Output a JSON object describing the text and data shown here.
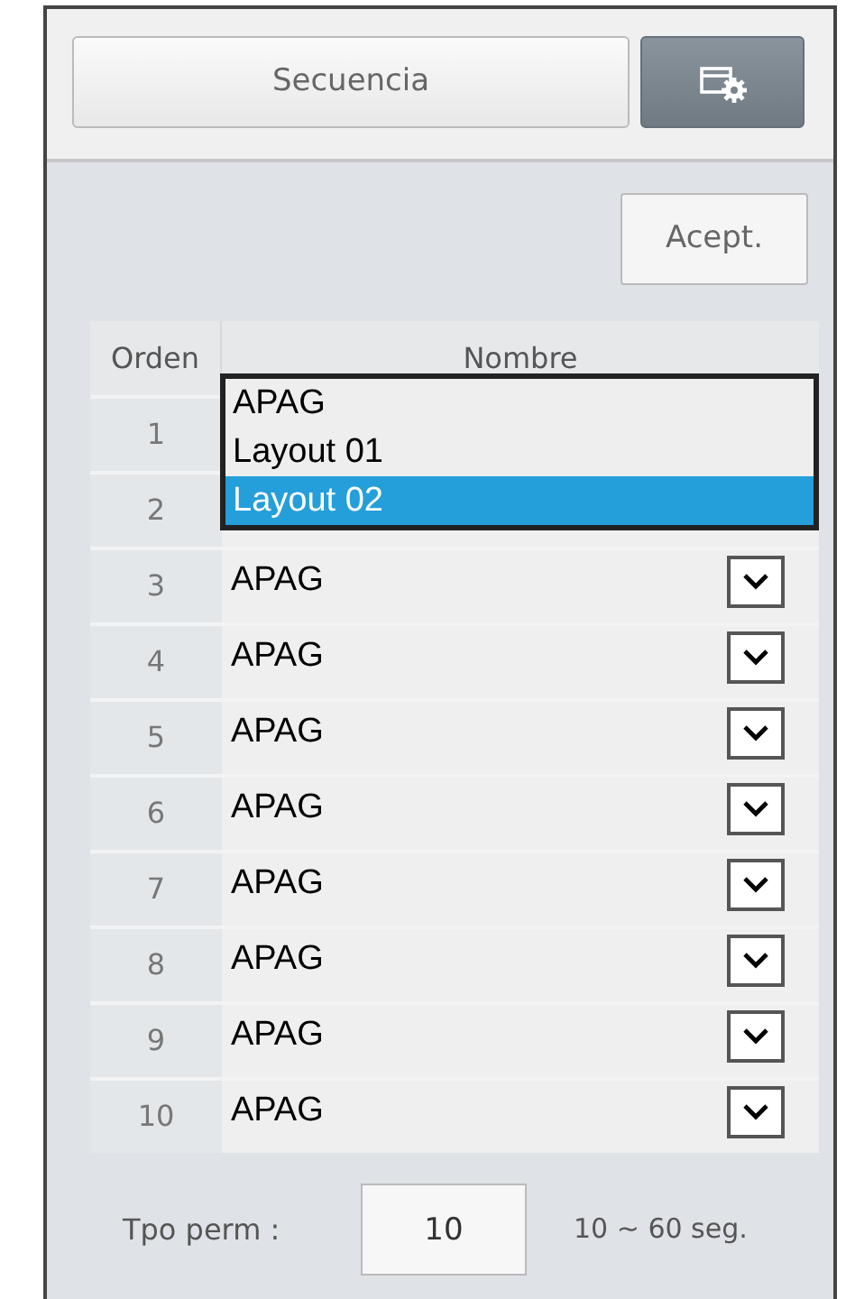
{
  "tabs": [
    {
      "kind": "text",
      "label": "Secuencia",
      "selected": false
    },
    {
      "kind": "icon",
      "selected": true
    }
  ],
  "accept_button": "Acept.",
  "table": {
    "columns": [
      "Orden",
      "Nombre"
    ],
    "rows": [
      {
        "order": "1"
      },
      {
        "order": "2"
      },
      {
        "order": "3",
        "name": "APAG"
      },
      {
        "order": "4",
        "name": "APAG"
      },
      {
        "order": "5",
        "name": "APAG"
      },
      {
        "order": "6",
        "name": "APAG"
      },
      {
        "order": "7",
        "name": "APAG"
      },
      {
        "order": "8",
        "name": "APAG"
      },
      {
        "order": "9",
        "name": "APAG"
      },
      {
        "order": "10",
        "name": "APAG"
      }
    ]
  },
  "dropdown": {
    "options": [
      {
        "label": "APAG",
        "selected": false
      },
      {
        "label": "Layout 01",
        "selected": false
      },
      {
        "label": "Layout 02",
        "selected": true
      }
    ]
  },
  "dwell": {
    "label": "Tpo perm :",
    "value": "10",
    "range": "10 ~ 60 seg."
  }
}
